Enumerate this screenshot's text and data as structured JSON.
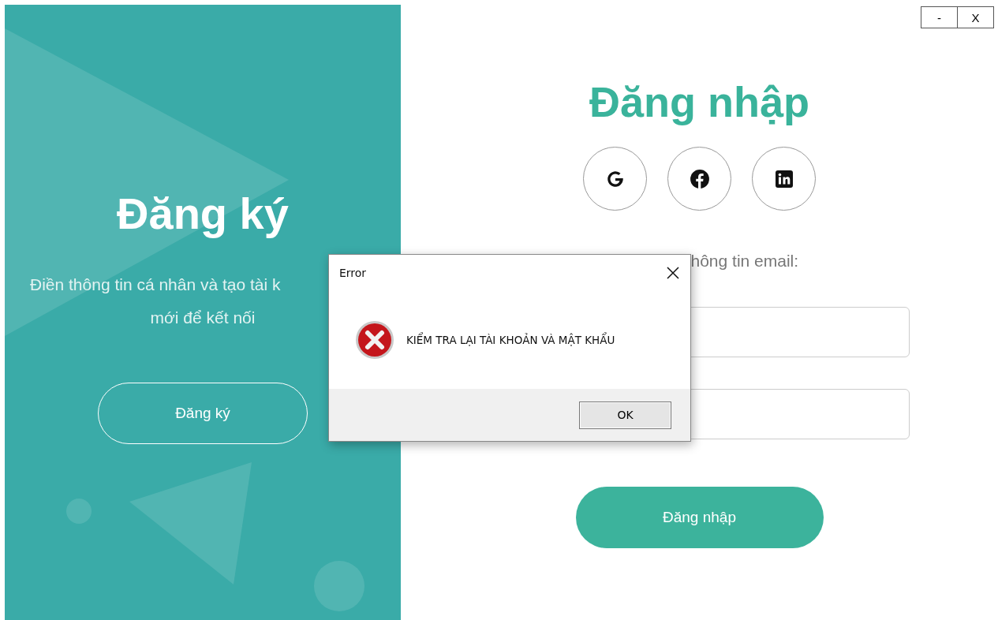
{
  "window_controls": [
    "-",
    "X"
  ],
  "signup_panel": {
    "title": "Đăng ký",
    "text_line_1": "Điền thông tin cá nhân và tạo tài k",
    "text_line_2": "mới để kết nối",
    "button": "Đăng ký"
  },
  "login": {
    "title": "Đăng nhập",
    "social": [
      {
        "kind": "google"
      },
      {
        "kind": "facebook"
      },
      {
        "kind": "linkedin"
      }
    ],
    "hint": "hông tin email:",
    "button": "Đăng nhập"
  },
  "dialog": {
    "title": "Error",
    "message": "KIỂM TRA LẠI TÀI KHOẢN VÀ MẬT KHẨU",
    "button": "OK"
  }
}
